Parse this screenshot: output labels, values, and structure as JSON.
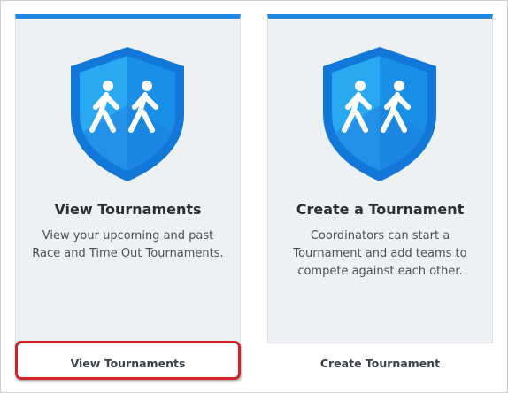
{
  "cards": [
    {
      "title": "View Tournaments",
      "description": "View your upcoming and past Race and Time Out Tournaments.",
      "button_label": "View Tournaments",
      "icon": "walking-people-shield-icon"
    },
    {
      "title": "Create a Tournament",
      "description": "Coordinators can start a Tournament and add teams to compete against each other.",
      "button_label": "Create Tournament",
      "icon": "walking-people-shield-icon"
    }
  ],
  "colors": {
    "accent": "#1f87e6",
    "shield_light": "#29a9f2",
    "shield_dark": "#1177d8",
    "highlight": "#d42027"
  }
}
